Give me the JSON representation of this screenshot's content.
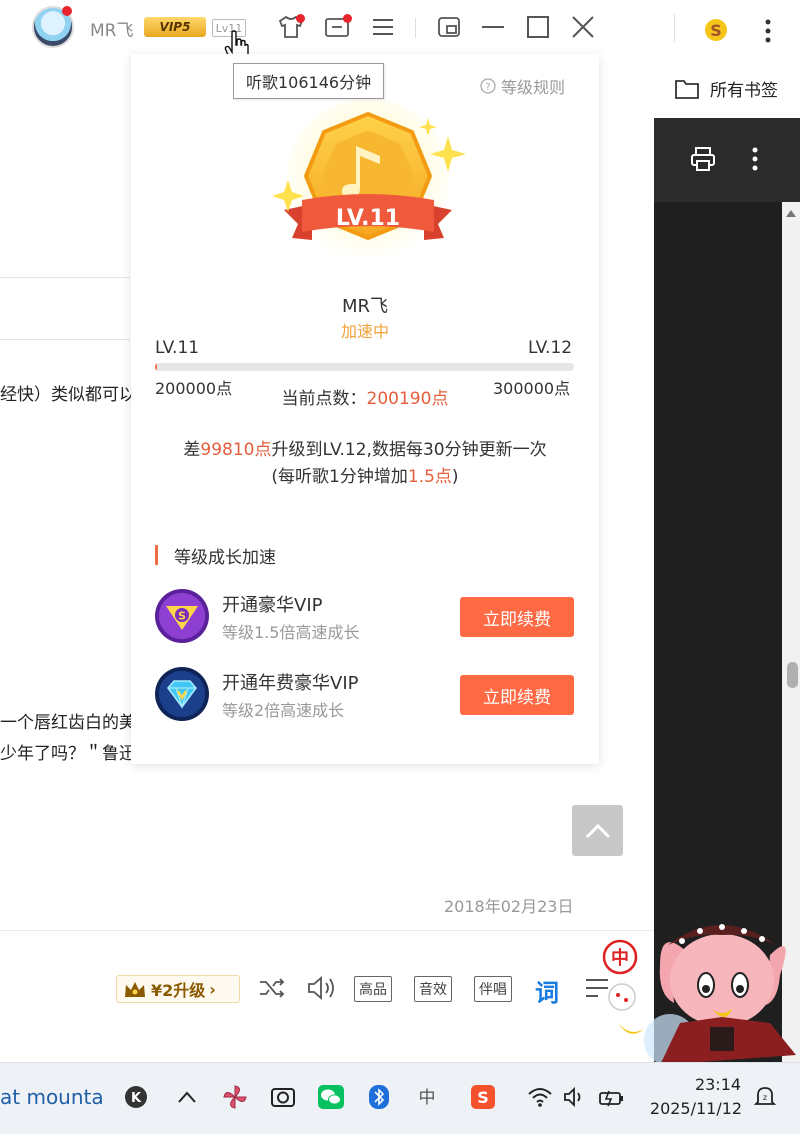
{
  "titlebar": {
    "username": "MR飞",
    "vip_label": "VIP5",
    "level_label": "Lv11",
    "tooltip": "听歌106146分钟"
  },
  "browser": {
    "bookmarks_label": "所有书签"
  },
  "background": {
    "line1": "经快）类似都可以",
    "line2": "一个唇红齿白的美",
    "line3": "少年了吗？＂鲁迅",
    "date": "2018年02月23日"
  },
  "popup": {
    "rules_label": "等级规则",
    "medal_label": "LV.11",
    "name": "MR飞",
    "status": "加速中",
    "level_current": "LV.11",
    "level_next": "LV.12",
    "points_min": "200000点",
    "points_max": "300000点",
    "progress_fraction": 0.0019,
    "current_points_label": "当前点数：",
    "current_points": "200190点",
    "info_prefix": "差",
    "info_points": "99810点",
    "info_suffix": "升级到LV.12,数据每30分钟更新一次",
    "rate_prefix": "(每听歌1分钟增加",
    "rate_value": "1.5点",
    "rate_suffix": ")",
    "section_title": "等级成长加速",
    "offers": [
      {
        "title": "开通豪华VIP",
        "subtitle": "等级1.5倍高速成长",
        "button": "立即续费",
        "icon": "vip-s-icon"
      },
      {
        "title": "开通年费豪华VIP",
        "subtitle": "等级2倍高速成长",
        "button": "立即续费",
        "icon": "annual-vip-diamond-icon"
      }
    ]
  },
  "player": {
    "upgrade_label": "¥2升级",
    "quality_label": "高品",
    "effect_label": "音效",
    "accompany_label": "伴唱",
    "lyric_label": "词"
  },
  "taskbar": {
    "search_text": "at mounta",
    "time": "23:14",
    "date": "2025/11/12"
  },
  "colors": {
    "accent": "#ef6b45",
    "button": "#ff6a45",
    "status": "#f0a33a",
    "lyric_blue": "#1a7be0"
  }
}
